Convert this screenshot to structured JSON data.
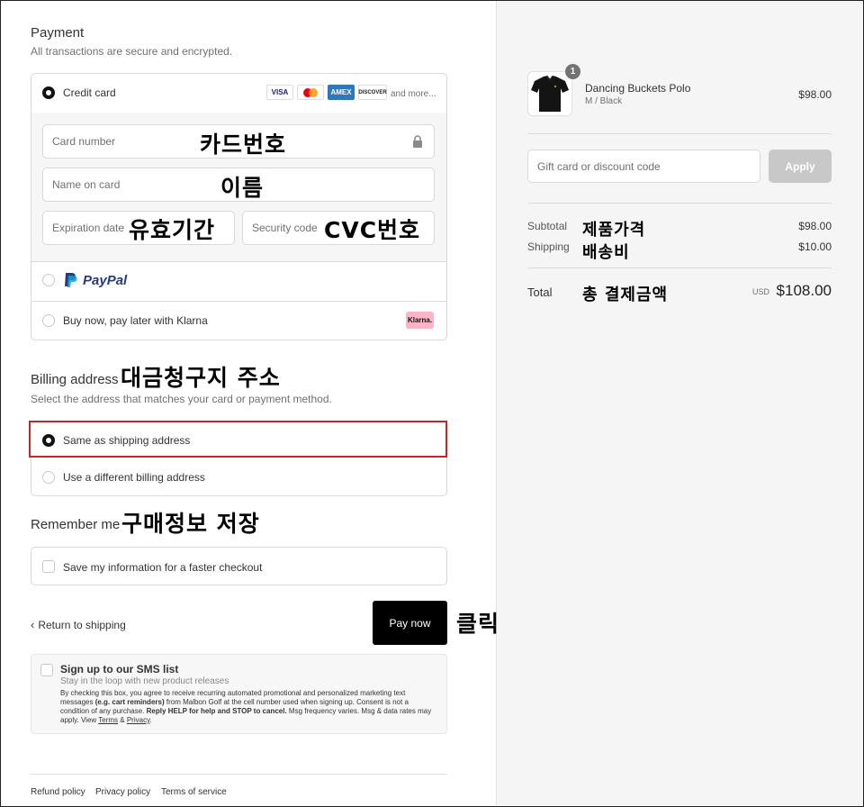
{
  "payment": {
    "title": "Payment",
    "subtitle": "All transactions are secure and encrypted.",
    "credit_card_label": "Credit card",
    "card_brands": [
      "VISA",
      "Mastercard",
      "AMEX",
      "DISCOVER"
    ],
    "and_more": "and more...",
    "card_number_placeholder": "Card number",
    "name_on_card_placeholder": "Name on card",
    "expiration_placeholder": "Expiration date",
    "security_code_placeholder": "Security code",
    "paypal_label": "PayPal",
    "klarna_label": "Buy now, pay later with Klarna",
    "klarna_badge": "Klarna."
  },
  "billing": {
    "title": "Billing address",
    "subtitle": "Select the address that matches your card or payment method.",
    "same_as_shipping": "Same as shipping address",
    "different_billing": "Use a different billing address"
  },
  "remember": {
    "title": "Remember me",
    "save_info": "Save my information for a faster checkout"
  },
  "actions": {
    "return_label": "Return to shipping",
    "pay_now": "Pay now"
  },
  "sms": {
    "title": "Sign up to our SMS list",
    "subtitle": "Stay in the loop with new product releases",
    "body_1": "By checking this box, you agree to receive recurring automated promotional and personalized marketing text messages",
    "body_bold_1": "(e.g. cart reminders)",
    "body_2": "from Malbon Golf at the cell number used when signing up. Consent is not a condition of any purchase.",
    "body_bold_2": "Reply HELP for help and STOP to cancel.",
    "body_3": "Msg frequency varies. Msg & data rates may apply. View",
    "terms": "Terms",
    "amp": "&",
    "privacy": "Privacy",
    "period": "."
  },
  "footer": {
    "refund": "Refund policy",
    "privacy": "Privacy policy",
    "terms": "Terms of service"
  },
  "annotations": {
    "card_number": "카드번호",
    "name": "이름",
    "expiry": "유효기간",
    "cvc": "CVC번호",
    "billing": "대금청구지 주소",
    "remember": "구매정보 저장",
    "click": "클릭",
    "product_price": "제품가격",
    "shipping_fee": "배송비",
    "total": "총 결제금액"
  },
  "summary": {
    "item_name": "Dancing Buckets Polo",
    "item_variant": "M / Black",
    "item_price": "$98.00",
    "item_qty": "1",
    "discount_placeholder": "Gift card or discount code",
    "apply": "Apply",
    "subtotal_label": "Subtotal",
    "subtotal_value": "$98.00",
    "shipping_label": "Shipping",
    "shipping_value": "$10.00",
    "total_label": "Total",
    "currency": "USD",
    "total_value": "$108.00"
  },
  "colors": {
    "highlight_border": "#c0272d",
    "pay_button": "#000000",
    "apply_button": "#c8c8c8",
    "paypal_dark": "#253b80",
    "paypal_light": "#179bd7",
    "klarna_badge": "#ffb3c7"
  }
}
